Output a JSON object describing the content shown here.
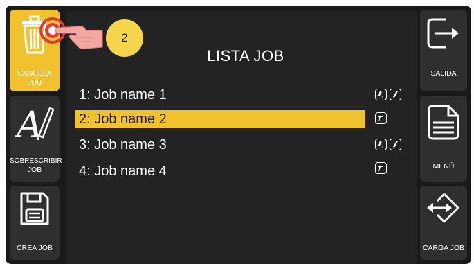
{
  "left_panel": {
    "cancel": {
      "line1": "CANCELA",
      "line2": "JOB"
    },
    "overwrite": {
      "line1": "SOBRESCRIBIR",
      "line2": "JOB"
    },
    "create": {
      "label": "CREA JOB"
    }
  },
  "right_panel": {
    "exit": {
      "label": "SALIDA"
    },
    "menu": {
      "label": "MENÚ"
    },
    "load": {
      "label": "CARGA JOB"
    }
  },
  "main": {
    "title": "LISTA JOB",
    "jobs": [
      {
        "label": "1: Job name 1",
        "selected": false,
        "icons": [
          "stick-electrode-dc-icon",
          "pencil-icon"
        ]
      },
      {
        "label": "2: Job name 2",
        "selected": true,
        "icons": [
          "mig-torch-icon"
        ]
      },
      {
        "label": "3: Job name 3",
        "selected": false,
        "icons": [
          "stick-electrode-dc-icon",
          "pencil-icon"
        ]
      },
      {
        "label": "4: Job name 4",
        "selected": false,
        "icons": [
          "mig-torch-icon"
        ]
      }
    ]
  },
  "tutorial": {
    "step_number": "2"
  },
  "colors": {
    "accent": "#f2c12e",
    "panel": "#2f2f2f",
    "background": "#1a1a1a"
  }
}
